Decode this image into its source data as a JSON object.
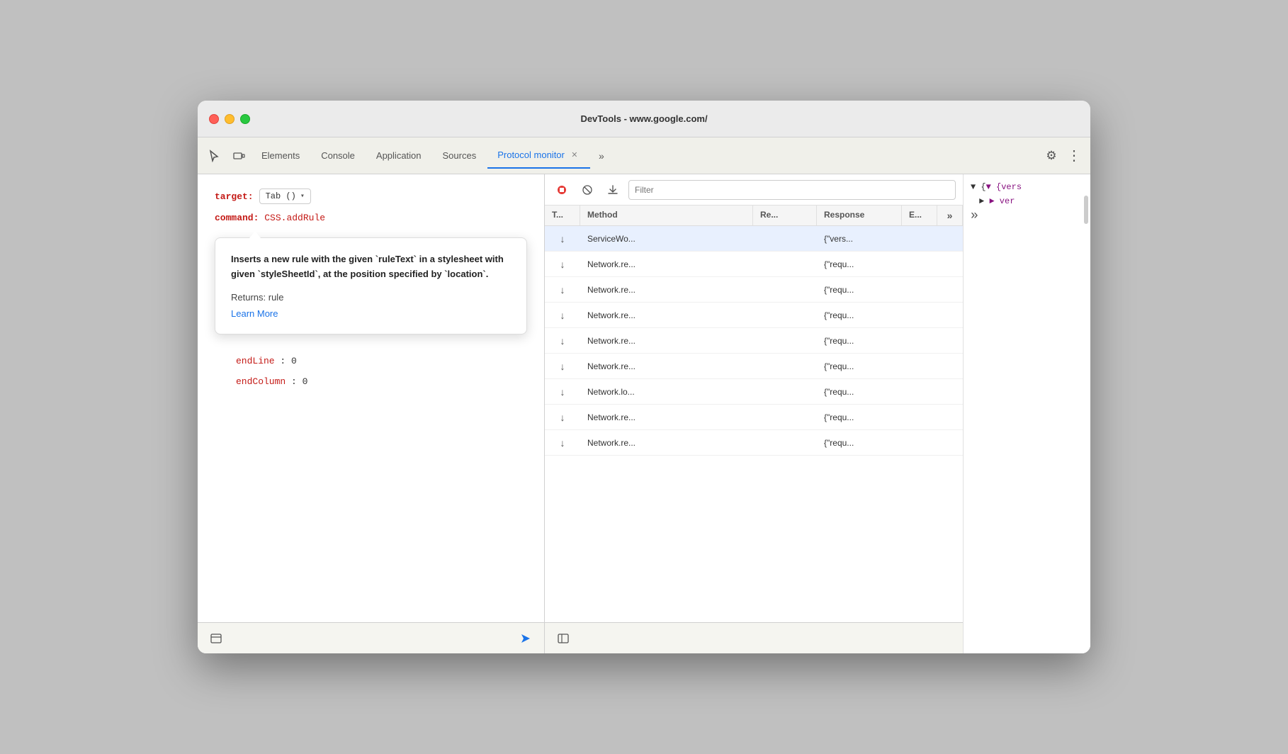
{
  "window": {
    "title": "DevTools - www.google.com/"
  },
  "tabs": [
    {
      "id": "cursor",
      "label": "",
      "icon": "cursor",
      "active": false
    },
    {
      "id": "device",
      "label": "",
      "icon": "device-toolbar",
      "active": false
    },
    {
      "id": "elements",
      "label": "Elements",
      "active": false
    },
    {
      "id": "console",
      "label": "Console",
      "active": false
    },
    {
      "id": "application",
      "label": "Application",
      "active": false
    },
    {
      "id": "sources",
      "label": "Sources",
      "active": false
    },
    {
      "id": "protocol-monitor",
      "label": "Protocol monitor",
      "active": true
    }
  ],
  "target": {
    "label": "target:",
    "value": "Tab ()",
    "dropdown_arrow": "▾"
  },
  "command": {
    "label": "command:",
    "value": "CSS.addRule"
  },
  "tooltip": {
    "description": "Inserts a new rule with the given `ruleText` in a stylesheet with given `styleSheetId`, at the position specified by `location`.",
    "returns": "Returns: rule",
    "learn_more": "Learn More"
  },
  "params": [
    {
      "name": "endLine",
      "separator": ":",
      "value": "0"
    },
    {
      "name": "endColumn",
      "separator": ":",
      "value": "0"
    }
  ],
  "protocol_toolbar": {
    "filter_placeholder": "Filter"
  },
  "table": {
    "headers": [
      "T...",
      "Method",
      "Re...",
      "Response",
      "E..."
    ],
    "rows": [
      {
        "type": "↓",
        "method": "ServiceWo...",
        "re": "",
        "response": "{\"vers...",
        "e": "",
        "selected": true
      },
      {
        "type": "↓",
        "method": "Network.re...",
        "re": "",
        "response": "{\"requ...",
        "e": ""
      },
      {
        "type": "↓",
        "method": "Network.re...",
        "re": "",
        "response": "{\"requ...",
        "e": ""
      },
      {
        "type": "↓",
        "method": "Network.re...",
        "re": "",
        "response": "{\"requ...",
        "e": ""
      },
      {
        "type": "↓",
        "method": "Network.re...",
        "re": "",
        "response": "{\"requ...",
        "e": ""
      },
      {
        "type": "↓",
        "method": "Network.re...",
        "re": "",
        "response": "{\"requ...",
        "e": ""
      },
      {
        "type": "↓",
        "method": "Network.lo...",
        "re": "",
        "response": "{\"requ...",
        "e": ""
      },
      {
        "type": "↓",
        "method": "Network.re...",
        "re": "",
        "response": "{\"requ...",
        "e": ""
      },
      {
        "type": "↓",
        "method": "Network.re...",
        "re": "",
        "response": "{\"requ...",
        "e": ""
      }
    ]
  },
  "detail_panel": {
    "line1": "▼ {vers",
    "line2": "► ver"
  },
  "icons": {
    "cursor": "⌖",
    "device_toolbar": "⬜",
    "more_tabs": "»",
    "settings": "⚙",
    "kebab": "⋮",
    "record_stop": "⏹",
    "clear": "⊘",
    "export": "⬇",
    "send": "▷",
    "sidebar_toggle": "⊡",
    "collapse": "«"
  },
  "colors": {
    "active_tab": "#1a73e8",
    "label_red": "#c41a16",
    "link_blue": "#1a73e8",
    "arrow_blue": "#1a73e8"
  }
}
